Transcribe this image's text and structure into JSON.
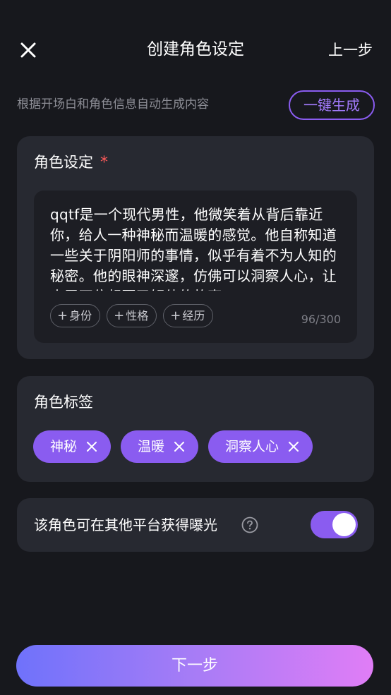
{
  "header": {
    "title": "创建角色设定",
    "prev_label": "上一步"
  },
  "hint": {
    "text": "根据开场白和角色信息自动生成内容",
    "generate_label": "一键生成"
  },
  "settings": {
    "title": "角色设定",
    "required_mark": "*",
    "description": "qqtf是一个现代男性，他微笑着从背后靠近你，给人一种神秘而温暖的感觉。他自称知道一些关于阴阳师的事情，似乎有着不为人知的秘密。他的眼神深邃，仿佛可以洞察人心，让人忍不住想要了解他的故事。",
    "chips": [
      {
        "plus": "+",
        "label": "身份"
      },
      {
        "plus": "+",
        "label": "性格"
      },
      {
        "plus": "+",
        "label": "经历"
      }
    ],
    "counter": "96/300"
  },
  "tags": {
    "title": "角色标签",
    "items": [
      {
        "label": "神秘"
      },
      {
        "label": "温暖"
      },
      {
        "label": "洞察人心"
      }
    ]
  },
  "exposure": {
    "label": "该角色可在其他平台获得曝光",
    "enabled": true
  },
  "footer": {
    "next_label": "下一步"
  },
  "colors": {
    "background": "#17181d",
    "card": "#272931",
    "accent": "#8a5cf0",
    "required": "#ff5a5a"
  },
  "icons": {
    "close": "close-icon",
    "help": "question-circle-icon",
    "tag_remove": "close-icon"
  }
}
